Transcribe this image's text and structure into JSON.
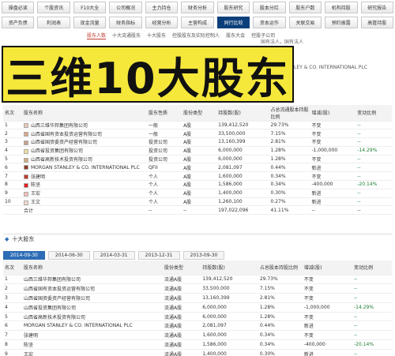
{
  "nav": {
    "row1": [
      "操盘必读",
      "个股资讯",
      "F10大全",
      "公司概况",
      "主力持仓",
      "财务分析",
      "股东研究",
      "股本分红",
      "股东户数",
      "机构持股",
      "研究报告"
    ],
    "row2": [
      "资产负债",
      "利润表",
      "现金流量",
      "财务指标",
      "经营分析",
      "主营构成",
      "同行比较",
      "资本运作",
      "关联交易",
      "预约披露",
      "高管持股"
    ],
    "active_row": 1,
    "active_index": 6
  },
  "subtabs": [
    "股东人数",
    "十大流通股东",
    "十大股东",
    "控股股东及实际控制人",
    "股东大会",
    "控股子公司"
  ],
  "subtabs_active": 0,
  "side_notes": [
    "国有法人，国有法人",
    "LEY & CO. INTERNATIONAL PLC"
  ],
  "banner": {
    "text": "三维10大股东",
    "bg": "#f6e83a"
  },
  "table1": {
    "headers": [
      "名次",
      "股东名称",
      "股东性质",
      "股份类型",
      "持股数(股)",
      "占总流通股本持股比例",
      "增减(股)",
      "变动比例"
    ],
    "rows": [
      {
        "idx": "1",
        "color": "#e8c9b5",
        "name": "山西三维华邦集团有限公司",
        "nature": "一般",
        "type": "A股",
        "shares": "139,412,520",
        "pct": "29.73%",
        "change": "不变",
        "ratio": "--"
      },
      {
        "idx": "2",
        "color": "#d9a88a",
        "name": "山西省国有资本投资运营有限公司",
        "nature": "一般",
        "type": "A股",
        "shares": "33,500,000",
        "pct": "7.15%",
        "change": "不变",
        "ratio": "--"
      },
      {
        "idx": "3",
        "color": "#c9a08a",
        "name": "山西省国资委资产经营有限公司",
        "nature": "投资公司",
        "type": "A股",
        "shares": "13,160,399",
        "pct": "2.81%",
        "change": "不变",
        "ratio": "--"
      },
      {
        "idx": "4",
        "color": "#f0e0a0",
        "name": "山西省投资集团有限公司",
        "nature": "投资公司",
        "type": "A股",
        "shares": "6,000,000",
        "pct": "1.28%",
        "change": "-1,000,000",
        "ratio": "-14.29%"
      },
      {
        "idx": "5",
        "color": "#d0b080",
        "name": "山西省高新技术投资有限公司",
        "nature": "投资公司",
        "type": "A股",
        "shares": "6,000,000",
        "pct": "1.28%",
        "change": "不变",
        "ratio": "--"
      },
      {
        "idx": "6",
        "color": "#8b3a1e",
        "name": "MORGAN STANLEY & CO. INTERNATIONAL PLC",
        "nature": "QFII",
        "type": "A股",
        "shares": "2,081,097",
        "pct": "0.44%",
        "change": "新进",
        "ratio": "--"
      },
      {
        "idx": "7",
        "color": "#c0392b",
        "name": "张建明",
        "nature": "个人",
        "type": "A股",
        "shares": "1,600,000",
        "pct": "0.34%",
        "change": "不变",
        "ratio": "--"
      },
      {
        "idx": "8",
        "color": "#e02020",
        "name": "陈坚",
        "nature": "个人",
        "type": "A股",
        "shares": "1,586,000",
        "pct": "0.34%",
        "change": "-400,000",
        "ratio": "-20.14%"
      },
      {
        "idx": "9",
        "color": "#f4c0b8",
        "name": "王宏",
        "nature": "个人",
        "type": "A股",
        "shares": "1,400,000",
        "pct": "0.30%",
        "change": "新进",
        "ratio": "--"
      },
      {
        "idx": "10",
        "color": "#f5d9cc",
        "name": "王文",
        "nature": "个人",
        "type": "A股",
        "shares": "1,260,100",
        "pct": "0.27%",
        "change": "新进",
        "ratio": "--"
      }
    ],
    "total": {
      "label": "合计",
      "nature": "--",
      "type": "--",
      "shares": "197,022,096",
      "pct": "41.11%",
      "change": "--",
      "ratio": "--"
    }
  },
  "section2": {
    "title": "十大股东",
    "dates": [
      "2014-09-30",
      "2014-06-30",
      "2014-03-31",
      "2013-12-31",
      "2013-09-30"
    ],
    "active_date": 0
  },
  "table2": {
    "headers": [
      "名次",
      "股东名称",
      "股份类型",
      "持股数(股)",
      "占总股本持股比例",
      "增减(股)",
      "变动比例"
    ],
    "rows": [
      {
        "idx": "1",
        "name": "山西三维华邦集团有限公司",
        "type": "流通A股",
        "shares": "139,412,520",
        "pct": "29.73%",
        "change": "不变",
        "ratio": "--"
      },
      {
        "idx": "2",
        "name": "山西省国有资本投资运营有限公司",
        "type": "流通A股",
        "shares": "33,500,000",
        "pct": "7.15%",
        "change": "不变",
        "ratio": "--"
      },
      {
        "idx": "3",
        "name": "山西省国资委资产经营有限公司",
        "type": "流通A股",
        "shares": "13,160,399",
        "pct": "2.81%",
        "change": "不变",
        "ratio": "--"
      },
      {
        "idx": "4",
        "name": "山西省投资集团有限公司",
        "type": "流通A股",
        "shares": "6,000,000",
        "pct": "1.28%",
        "change": "-1,000,000",
        "ratio": "-14.29%"
      },
      {
        "idx": "5",
        "name": "山西省高新技术投资有限公司",
        "type": "流通A股",
        "shares": "6,000,000",
        "pct": "1.28%",
        "change": "不变",
        "ratio": "--"
      },
      {
        "idx": "6",
        "name": "MORGAN STANLEY & CO. INTERNATIONAL PLC",
        "type": "流通A股",
        "shares": "2,081,097",
        "pct": "0.44%",
        "change": "新进",
        "ratio": "--"
      },
      {
        "idx": "7",
        "name": "张建明",
        "type": "流通A股",
        "shares": "1,600,000",
        "pct": "0.34%",
        "change": "不变",
        "ratio": "--"
      },
      {
        "idx": "8",
        "name": "陈坚",
        "type": "流通A股",
        "shares": "1,586,000",
        "pct": "0.34%",
        "change": "-400,000",
        "ratio": "-20.14%"
      },
      {
        "idx": "9",
        "name": "王宏",
        "type": "流通A股",
        "shares": "1,400,000",
        "pct": "0.30%",
        "change": "新进",
        "ratio": "--"
      }
    ]
  }
}
